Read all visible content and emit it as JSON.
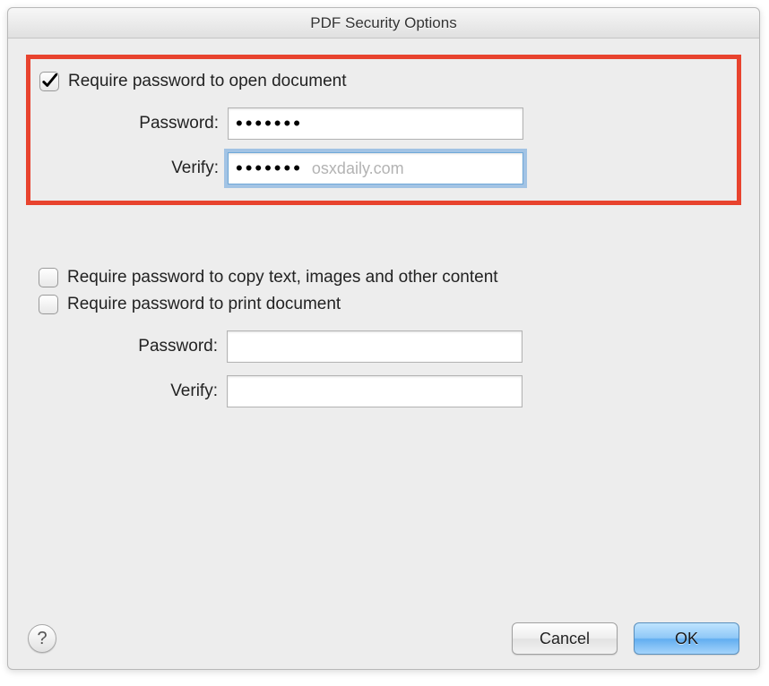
{
  "window": {
    "title": "PDF Security Options"
  },
  "open_section": {
    "checkbox_label": "Require password to open document",
    "checked": true,
    "password_label": "Password:",
    "password_value": "•••••••",
    "verify_label": "Verify:",
    "verify_value": "•••••••",
    "watermark": "osxdaily.com"
  },
  "perm_section": {
    "copy_label": "Require password to copy text, images and other content",
    "copy_checked": false,
    "print_label": "Require password to print document",
    "print_checked": false,
    "password_label": "Password:",
    "password_value": "",
    "verify_label": "Verify:",
    "verify_value": ""
  },
  "footer": {
    "help": "?",
    "cancel": "Cancel",
    "ok": "OK"
  }
}
